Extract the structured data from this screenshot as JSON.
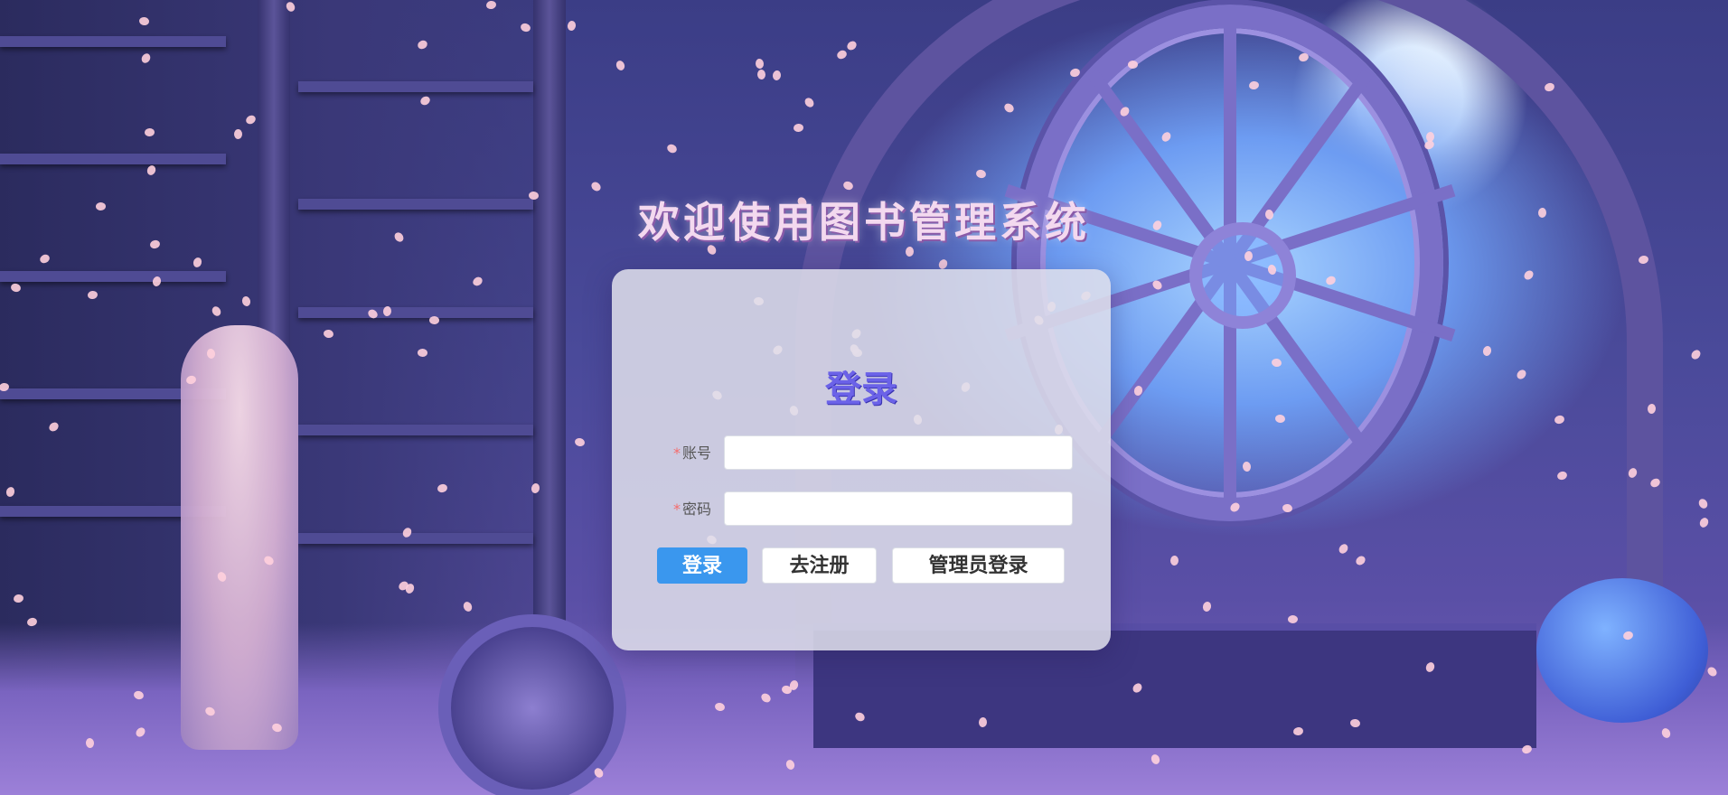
{
  "page": {
    "welcome_title": "欢迎使用图书管理系统"
  },
  "login_card": {
    "title": "登录",
    "account_label": "账号",
    "password_label": "密码",
    "required_mark": "*",
    "account_value": "",
    "password_value": "",
    "login_button": "登录",
    "register_button": "去注册",
    "admin_login_button": "管理员登录"
  },
  "colors": {
    "primary": "#3a97ee",
    "title_color": "#6b62e8",
    "welcome_color": "#f3d9ef",
    "required": "#f56c6c"
  }
}
